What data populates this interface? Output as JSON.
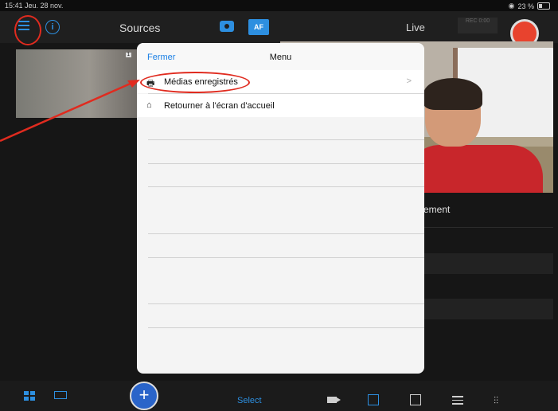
{
  "status_bar": {
    "time_date": "15:41  Jeu. 28 nov.",
    "battery": "23 %"
  },
  "top_bar": {
    "sources_title": "Sources",
    "af_label": "AF",
    "live_title": "Live",
    "rec_box": "REC\n0:00"
  },
  "thumbnail": {
    "badge": "1"
  },
  "right_panel": {
    "label": "ement"
  },
  "modal": {
    "close_label": "Fermer",
    "title": "Menu",
    "items": [
      {
        "label": "Médias enregistrés",
        "icon": "printer-icon",
        "chevron": ">"
      },
      {
        "label": "Retourner à l'écran d'accueil",
        "icon": "home-icon",
        "chevron": ""
      }
    ]
  },
  "bottom_bar": {
    "select_label": "Select",
    "plus_label": "+"
  },
  "colors": {
    "accent": "#2d8fe0",
    "record": "#e8432e",
    "annotation": "#e02b1f"
  }
}
